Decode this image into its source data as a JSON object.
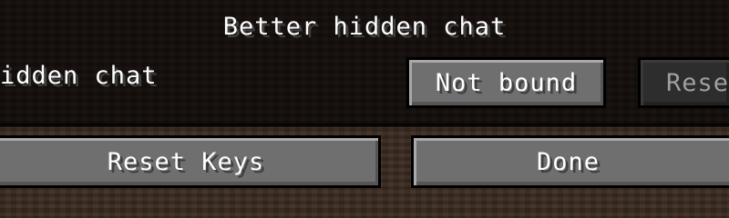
{
  "category": {
    "title": "Better hidden chat"
  },
  "keybind": {
    "label": "idden chat",
    "binding_label": "Not bound",
    "reset_label": "Rese"
  },
  "footer": {
    "reset_keys_label": "Reset Keys",
    "done_label": "Done"
  }
}
